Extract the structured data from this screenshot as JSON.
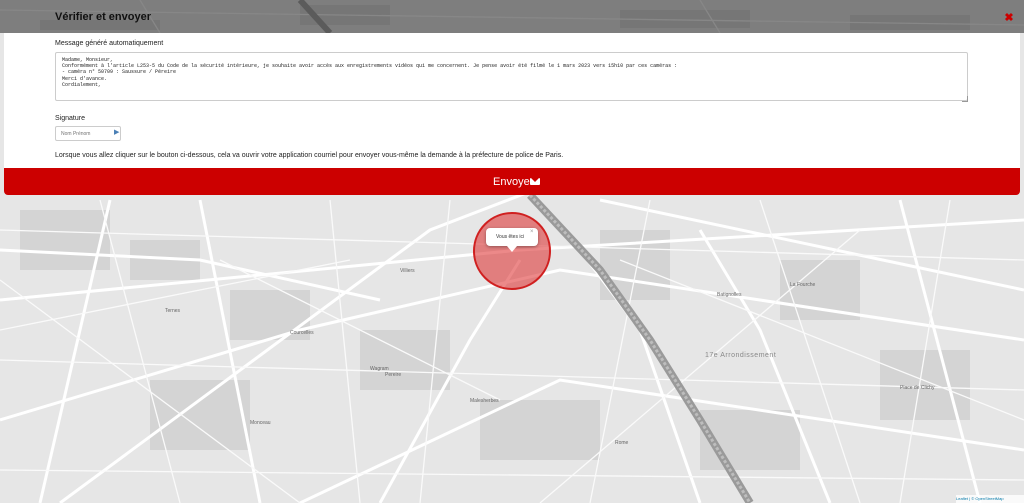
{
  "modal": {
    "title": "Vérifier et envoyer",
    "close_icon": "close-icon"
  },
  "message": {
    "label": "Message généré automatiquement",
    "text": "Madame, Monsieur,\nConformément à l'article L253-5 du Code de la sécurité intérieure, je souhaite avoir accès aux enregistrements vidéos qui me concernent. Je pense avoir été filmé le 1 mars 2023 vers 15h10 par ces caméras :\n- caméra n° 50709 : Saussure / Péreire\nMerci d'avance.\nCordialement,"
  },
  "signature": {
    "label": "Signature",
    "placeholder": "Nom Prénom"
  },
  "info_text": "Lorsque vous allez cliquer sur le bouton ci-dessous, cela va ouvrir votre application courriel pour envoyer vous-même la demande à la préfecture de police de Paris.",
  "send_button": {
    "label": "Envoyer",
    "icon": "envelope-icon"
  },
  "map": {
    "popup_text": "Vous êtes ici",
    "popup_close": "×",
    "attribution_leaflet": "Leaflet",
    "attribution_osm": "| © OpenStreetMap",
    "labels": {
      "l1": "Pereire",
      "l2": "Batignolles",
      "l3": "Wagram",
      "l4": "Malesherbes",
      "l5": "Monceau",
      "l6": "17e Arrondissement",
      "l7": "Courcelles",
      "l8": "Ternes",
      "l9": "Place de Clichy",
      "l10": "La Fourche",
      "l11": "Rome",
      "l12": "Villiers"
    }
  },
  "colors": {
    "accent": "#cc0000",
    "marker": "#d02020"
  }
}
